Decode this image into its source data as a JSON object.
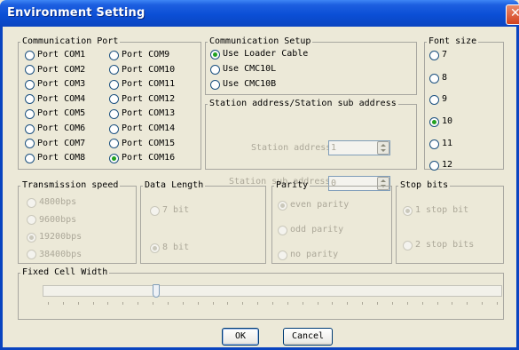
{
  "window": {
    "title": "Environment Setting",
    "close_glyph": "✕"
  },
  "comm_port": {
    "legend": "Communication Port",
    "ports": [
      {
        "label": "Port COM1",
        "checked": false
      },
      {
        "label": "Port COM2",
        "checked": false
      },
      {
        "label": "Port COM3",
        "checked": false
      },
      {
        "label": "Port COM4",
        "checked": false
      },
      {
        "label": "Port COM5",
        "checked": false
      },
      {
        "label": "Port COM6",
        "checked": false
      },
      {
        "label": "Port COM7",
        "checked": false
      },
      {
        "label": "Port COM8",
        "checked": false
      },
      {
        "label": "Port COM9",
        "checked": false
      },
      {
        "label": "Port COM10",
        "checked": false
      },
      {
        "label": "Port COM11",
        "checked": false
      },
      {
        "label": "Port COM12",
        "checked": false
      },
      {
        "label": "Port COM13",
        "checked": false
      },
      {
        "label": "Port COM14",
        "checked": false
      },
      {
        "label": "Port COM15",
        "checked": false
      },
      {
        "label": "Port COM16",
        "checked": true
      }
    ]
  },
  "comm_setup": {
    "legend": "Communication Setup",
    "options": [
      {
        "label": "Use Loader Cable",
        "checked": true
      },
      {
        "label": "Use CMC10L",
        "checked": false
      },
      {
        "label": "Use CMC10B",
        "checked": false
      }
    ]
  },
  "station": {
    "legend": "Station address/Station sub address",
    "address_label": "Station address",
    "address_value": "1",
    "sub_label": "Station sub address",
    "sub_value": "0"
  },
  "font_size": {
    "legend": "Font size",
    "options": [
      {
        "label": "7",
        "checked": false
      },
      {
        "label": "8",
        "checked": false
      },
      {
        "label": "9",
        "checked": false
      },
      {
        "label": "10",
        "checked": true
      },
      {
        "label": "11",
        "checked": false
      },
      {
        "label": "12",
        "checked": false
      }
    ]
  },
  "transmission": {
    "legend": "Transmission speed",
    "options": [
      {
        "label": "4800bps",
        "checked": false
      },
      {
        "label": "9600bps",
        "checked": false
      },
      {
        "label": "19200bps",
        "checked": true
      },
      {
        "label": "38400bps",
        "checked": false
      }
    ]
  },
  "data_length": {
    "legend": "Data Length",
    "options": [
      {
        "label": "7 bit",
        "checked": false
      },
      {
        "label": "8 bit",
        "checked": true
      }
    ]
  },
  "parity": {
    "legend": "Parity",
    "options": [
      {
        "label": "even parity",
        "checked": true
      },
      {
        "label": "odd  parity",
        "checked": false
      },
      {
        "label": "no parity",
        "checked": false
      }
    ]
  },
  "stop_bits": {
    "legend": "Stop bits",
    "options": [
      {
        "label": "1 stop bit",
        "checked": true
      },
      {
        "label": "2 stop bits",
        "checked": false
      }
    ]
  },
  "cell_width": {
    "legend": "Fixed Cell Width",
    "slider_position": 0.25,
    "tick_count": 31
  },
  "buttons": {
    "ok": "OK",
    "cancel": "Cancel"
  },
  "colors": {
    "title_bar": "#0a4fd6",
    "dialog_bg": "#ece9d8",
    "radio_dot": "#21a121",
    "disabled_text": "#aca899"
  }
}
